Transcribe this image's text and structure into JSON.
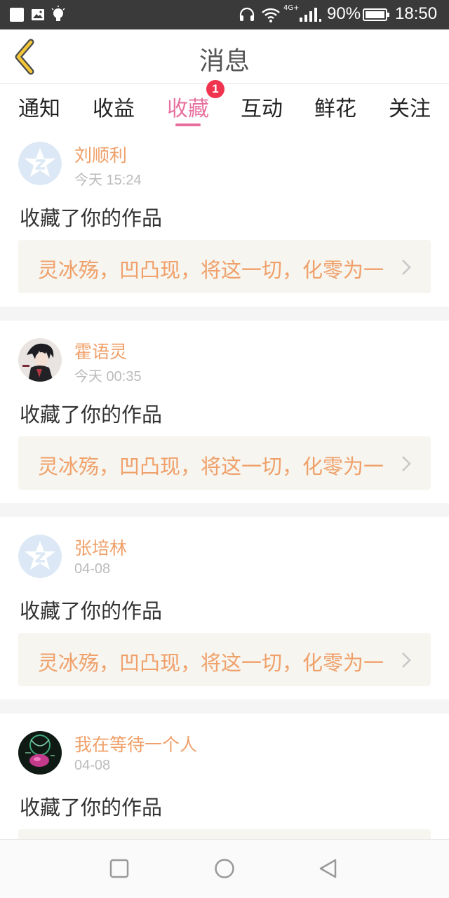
{
  "status_bar": {
    "network": "4G+",
    "battery": "90%",
    "time": "18:50"
  },
  "header": {
    "title": "消息",
    "back_icon": "chevron-left-icon"
  },
  "tabs": [
    {
      "label": "通知",
      "active": false
    },
    {
      "label": "收益",
      "active": false
    },
    {
      "label": "收藏",
      "active": true,
      "badge": "1"
    },
    {
      "label": "互动",
      "active": false
    },
    {
      "label": "鲜花",
      "active": false
    },
    {
      "label": "关注",
      "active": false
    }
  ],
  "colors": {
    "accent": "#e8709e",
    "username": "#f0a06a",
    "badge": "#f0334f",
    "link_bg": "#f6f5ef"
  },
  "items": [
    {
      "username": "刘顺利",
      "time": "今天 15:24",
      "action": "收藏了你的作品",
      "work": "灵冰殇，凹凸现，将这一切，化零为一",
      "avatar": "default-avatar-icon"
    },
    {
      "username": "霍语灵",
      "time": "今天 00:35",
      "action": "收藏了你的作品",
      "work": "灵冰殇，凹凸现，将这一切，化零为一",
      "avatar": "user-photo-avatar"
    },
    {
      "username": "张培林",
      "time": "04-08",
      "action": "收藏了你的作品",
      "work": "灵冰殇，凹凸现，将这一切，化零为一",
      "avatar": "default-avatar-icon"
    },
    {
      "username": "我在等待一个人",
      "time": "04-08",
      "action": "收藏了你的作品",
      "work": "",
      "avatar": "user-photo-avatar"
    }
  ],
  "nav": [
    "recent-apps-icon",
    "home-icon",
    "back-triangle-icon"
  ]
}
